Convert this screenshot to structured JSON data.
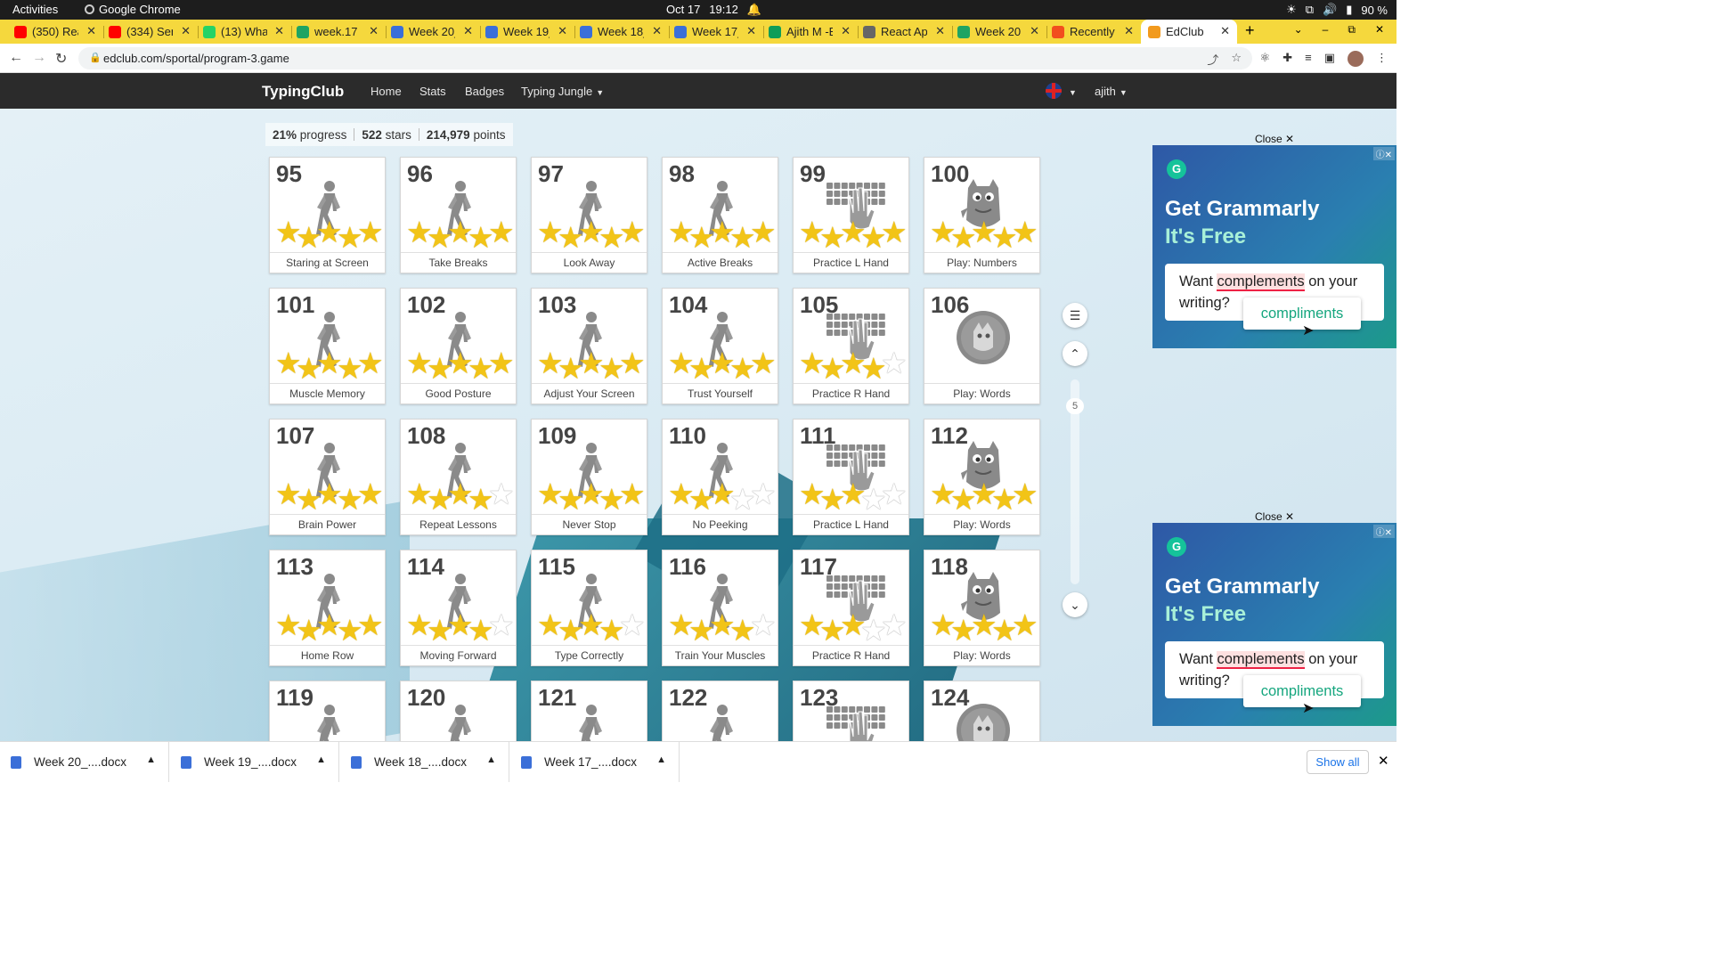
{
  "os_bar": {
    "activities": "Activities",
    "app_name": "Google Chrome",
    "date": "Oct 17",
    "time": "19:12",
    "battery": "90 %"
  },
  "browser": {
    "tabs": [
      {
        "title": "(350) Rea",
        "favicon_color": "#ff0000"
      },
      {
        "title": "(334) Sen",
        "favicon_color": "#ff0000"
      },
      {
        "title": "(13) What",
        "favicon_color": "#25d366"
      },
      {
        "title": "week.17 -",
        "favicon_color": "#1fa463"
      },
      {
        "title": "Week 20_",
        "favicon_color": "#3b6fd8"
      },
      {
        "title": "Week 19_",
        "favicon_color": "#3b6fd8"
      },
      {
        "title": "Week 18_",
        "favicon_color": "#3b6fd8"
      },
      {
        "title": "Week 17_",
        "favicon_color": "#3b6fd8"
      },
      {
        "title": "Ajith M -E",
        "favicon_color": "#0f9d58"
      },
      {
        "title": "React App",
        "favicon_color": "#666666"
      },
      {
        "title": "Week 20 -",
        "favicon_color": "#1fa463"
      },
      {
        "title": "Recently",
        "favicon_color": "#f24e1e"
      },
      {
        "title": "EdClub",
        "favicon_color": "#f29a1d",
        "active": true
      }
    ],
    "url": "edclub.com/sportal/program-3.game"
  },
  "site": {
    "brand": "TypingClub",
    "nav": [
      "Home",
      "Stats",
      "Badges",
      "Typing Jungle"
    ],
    "user": "ajith",
    "progress": {
      "percent": "21%",
      "percent_label": "progress",
      "stars": "522",
      "stars_label": "stars",
      "points": "214,979",
      "points_label": "points"
    }
  },
  "lessons": [
    {
      "num": "95",
      "label": "Staring at Screen",
      "type": "walker",
      "stars": 5
    },
    {
      "num": "96",
      "label": "Take Breaks",
      "type": "walker",
      "stars": 5
    },
    {
      "num": "97",
      "label": "Look Away",
      "type": "walker",
      "stars": 5
    },
    {
      "num": "98",
      "label": "Active Breaks",
      "type": "walker",
      "stars": 5
    },
    {
      "num": "99",
      "label": "Practice L Hand",
      "type": "keyboard",
      "stars": 5
    },
    {
      "num": "100",
      "label": "Play: Numbers",
      "type": "monster",
      "stars": 5
    },
    {
      "num": "101",
      "label": "Muscle Memory",
      "type": "walker",
      "stars": 5
    },
    {
      "num": "102",
      "label": "Good Posture",
      "type": "walker",
      "stars": 5
    },
    {
      "num": "103",
      "label": "Adjust Your Screen",
      "type": "walker",
      "stars": 5
    },
    {
      "num": "104",
      "label": "Trust Yourself",
      "type": "walker",
      "stars": 5
    },
    {
      "num": "105",
      "label": "Practice R Hand",
      "type": "keyboard",
      "stars": 4
    },
    {
      "num": "106",
      "label": "Play: Words",
      "type": "badge",
      "stars": 0
    },
    {
      "num": "107",
      "label": "Brain Power",
      "type": "walker",
      "stars": 5
    },
    {
      "num": "108",
      "label": "Repeat Lessons",
      "type": "walker",
      "stars": 4
    },
    {
      "num": "109",
      "label": "Never Stop",
      "type": "walker",
      "stars": 5
    },
    {
      "num": "110",
      "label": "No Peeking",
      "type": "walker",
      "stars": 3
    },
    {
      "num": "111",
      "label": "Practice L Hand",
      "type": "keyboard",
      "stars": 3
    },
    {
      "num": "112",
      "label": "Play: Words",
      "type": "monster",
      "stars": 5
    },
    {
      "num": "113",
      "label": "Home Row",
      "type": "walker",
      "stars": 5
    },
    {
      "num": "114",
      "label": "Moving Forward",
      "type": "walker",
      "stars": 4
    },
    {
      "num": "115",
      "label": "Type Correctly",
      "type": "walker",
      "stars": 4
    },
    {
      "num": "116",
      "label": "Train Your Muscles",
      "type": "walker",
      "stars": 4
    },
    {
      "num": "117",
      "label": "Practice R Hand",
      "type": "keyboard",
      "stars": 3
    },
    {
      "num": "118",
      "label": "Play: Words",
      "type": "monster",
      "stars": 5
    },
    {
      "num": "119",
      "label": "",
      "type": "walker",
      "stars": 0
    },
    {
      "num": "120",
      "label": "",
      "type": "walker",
      "stars": 0
    },
    {
      "num": "121",
      "label": "",
      "type": "walker",
      "stars": 0
    },
    {
      "num": "122",
      "label": "",
      "type": "walker",
      "stars": 0
    },
    {
      "num": "123",
      "label": "",
      "type": "keyboard",
      "stars": 0
    },
    {
      "num": "124",
      "label": "",
      "type": "badge",
      "stars": 0
    }
  ],
  "side_controls": {
    "page": "5"
  },
  "ads": [
    {
      "close": "Close",
      "title1": "Get Grammarly",
      "title2": "It's Free",
      "text_before": "Want ",
      "text_highlight": "complements",
      "text_after": " on your writing?",
      "suggestion": "compliments"
    },
    {
      "close": "Close",
      "title1": "Get Grammarly",
      "title2": "It's Free",
      "text_before": "Want ",
      "text_highlight": "complements",
      "text_after": " on your writing?",
      "suggestion": "compliments"
    }
  ],
  "downloads": {
    "items": [
      "Week 20_....docx",
      "Week 19_....docx",
      "Week 18_....docx",
      "Week 17_....docx"
    ],
    "show_all": "Show all"
  }
}
